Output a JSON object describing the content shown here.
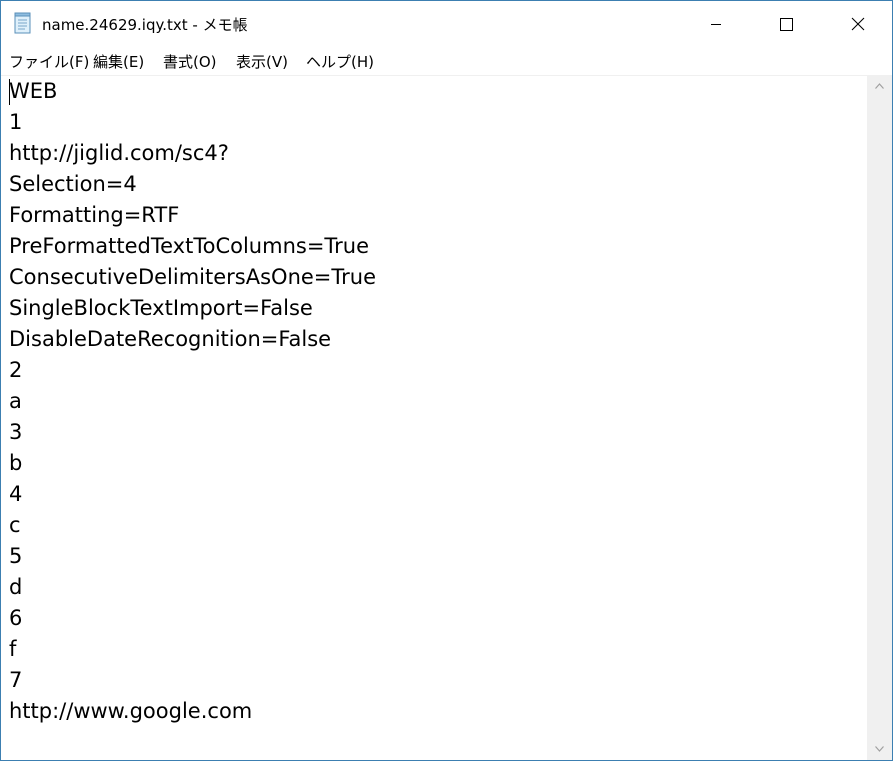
{
  "window": {
    "title": "name.24629.iqy.txt - メモ帳"
  },
  "icons": {
    "app": "notepad-icon",
    "minimize": "minimize-icon",
    "maximize": "maximize-icon",
    "close": "close-icon",
    "scroll_up": "scroll-up-arrow-icon",
    "scroll_down": "scroll-down-arrow-icon"
  },
  "menu": {
    "file": "ファイル(F)",
    "edit": "編集(E)",
    "format": "書式(O)",
    "view": "表示(V)",
    "help": "ヘルプ(H)"
  },
  "document": {
    "lines": [
      "WEB",
      "1",
      "http://jiglid.com/sc4?",
      "Selection=4",
      "Formatting=RTF",
      "PreFormattedTextToColumns=True",
      "ConsecutiveDelimitersAsOne=True",
      "SingleBlockTextImport=False",
      "DisableDateRecognition=False",
      "2",
      "a",
      "3",
      "b",
      "4",
      "c",
      "5",
      "d",
      "6",
      "f",
      "7",
      "http://www.google.com"
    ]
  },
  "colors": {
    "window_border": "#3c7fb1",
    "scrollbar": "#f0f0f0"
  }
}
